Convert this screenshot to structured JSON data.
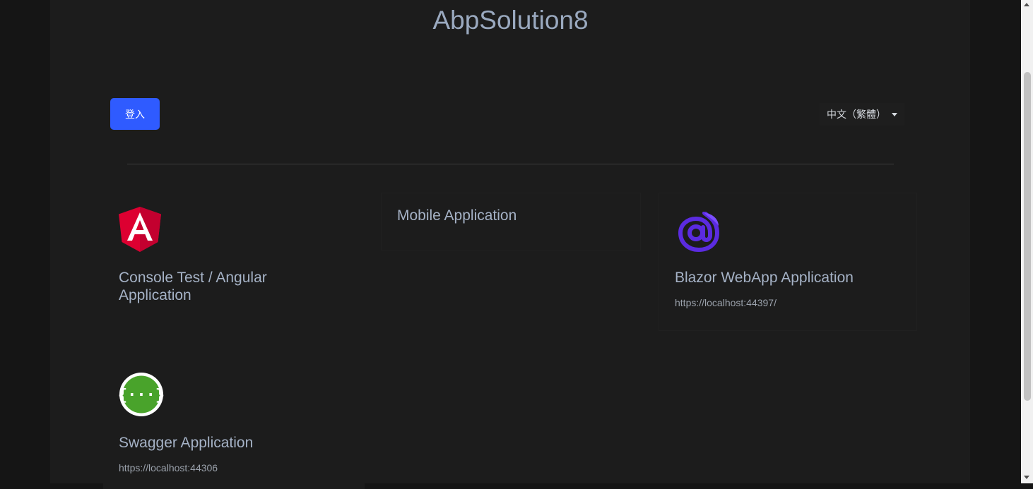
{
  "page": {
    "title": "AbpSolution8"
  },
  "toolbar": {
    "login_label": "登入",
    "language_label": "中文（繁體）"
  },
  "apps": [
    {
      "title": "Console Test / Angular Application",
      "url": "",
      "icon": "angular-icon"
    },
    {
      "title": "Mobile Application",
      "url": "",
      "icon": ""
    },
    {
      "title": "Blazor WebApp Application",
      "url": "https://localhost:44397/",
      "icon": "blazor-icon"
    },
    {
      "title": "Swagger Application",
      "url": "https://localhost:44306",
      "icon": "swagger-icon"
    }
  ],
  "colors": {
    "accent": "#2f5bff",
    "background": "#1c1c1c",
    "title": "#9aa9bf",
    "angular": "#dd0031",
    "blazor": "#5b2be0",
    "swagger": "#49a32b"
  }
}
